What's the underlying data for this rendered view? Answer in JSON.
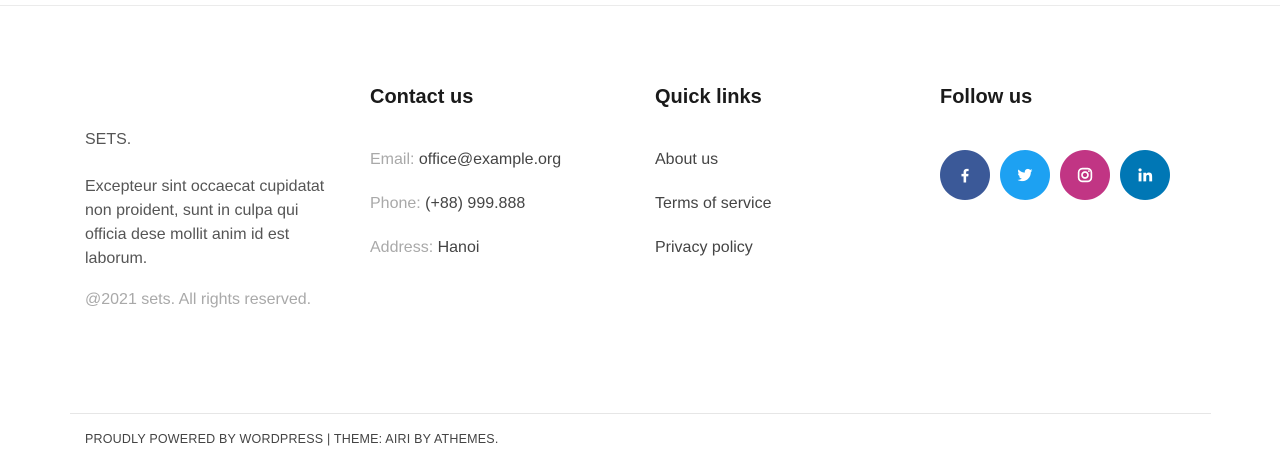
{
  "about": {
    "brand": "SETS.",
    "text": "Excepteur sint occaecat cupidatat non proident, sunt in culpa qui officia dese mollit anim id est laborum.",
    "copyright": "@2021 sets. All rights reserved."
  },
  "contact": {
    "title": "Contact us",
    "email_label": "Email:",
    "email_value": "office@example.org",
    "phone_label": "Phone:",
    "phone_value": "(+88) 999.888",
    "address_label": "Address:",
    "address_value": "Hanoi"
  },
  "quick_links": {
    "title": "Quick links",
    "items": [
      "About us",
      "Terms of service",
      "Privacy policy"
    ]
  },
  "follow": {
    "title": "Follow us",
    "icons": [
      {
        "name": "facebook-icon",
        "color": "#3b5998"
      },
      {
        "name": "twitter-icon",
        "color": "#1da1f2"
      },
      {
        "name": "instagram-icon",
        "color": "#c13584"
      },
      {
        "name": "linkedin-icon",
        "color": "#0077b5"
      }
    ]
  },
  "credits": {
    "prefix": "PROUDLY POWERED BY ",
    "wordpress": "WORDPRESS",
    "separator": " | THEME: ",
    "theme": "AIRI",
    "by": " BY ",
    "author": "ATHEMES",
    "suffix": "."
  }
}
